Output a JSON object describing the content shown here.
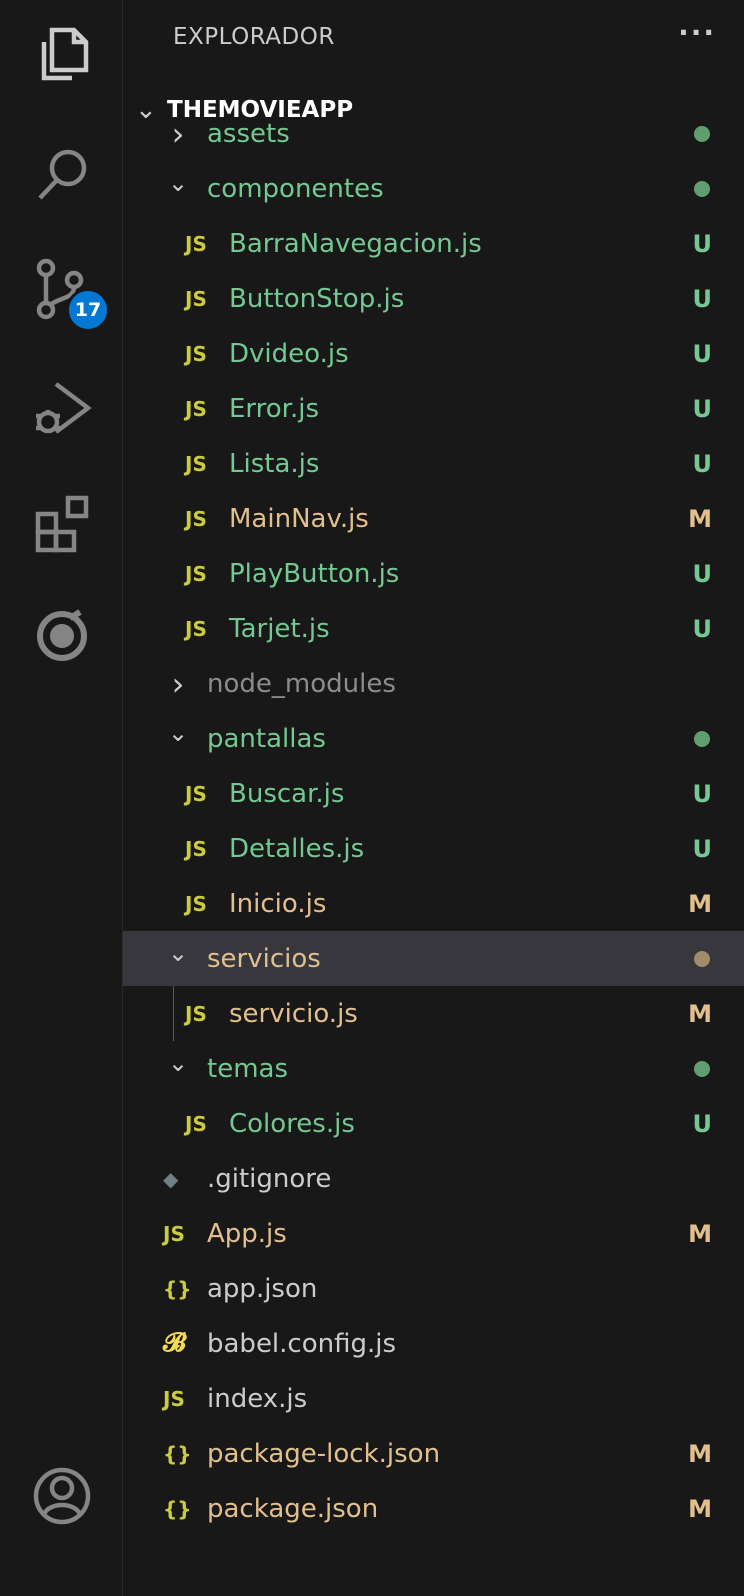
{
  "activity_bar": {
    "items": [
      {
        "icon": "files-icon",
        "name": "explorer"
      },
      {
        "icon": "search-icon",
        "name": "search"
      },
      {
        "icon": "source-control-icon",
        "name": "source-control",
        "badge": "17"
      },
      {
        "icon": "run-debug-icon",
        "name": "run-and-debug"
      },
      {
        "icon": "extensions-icon",
        "name": "extensions"
      },
      {
        "icon": "remote-icon",
        "name": "remote"
      }
    ],
    "account_icon": "account-icon"
  },
  "explorer": {
    "title": "EXPLORADOR",
    "more": "···",
    "project": "THEMOVIEAPP"
  },
  "tree": [
    {
      "type": "folder",
      "label": "assets",
      "open": false,
      "depth": 1,
      "color": "green",
      "status_dot": true,
      "partial": true
    },
    {
      "type": "folder",
      "label": "componentes",
      "open": true,
      "depth": 1,
      "color": "green",
      "status_dot": true
    },
    {
      "type": "js",
      "label": "BarraNavegacion.js",
      "depth": 2,
      "color": "green",
      "status": "U"
    },
    {
      "type": "js",
      "label": "ButtonStop.js",
      "depth": 2,
      "color": "green",
      "status": "U"
    },
    {
      "type": "js",
      "label": "Dvideo.js",
      "depth": 2,
      "color": "green",
      "status": "U"
    },
    {
      "type": "js",
      "label": "Error.js",
      "depth": 2,
      "color": "green",
      "status": "U"
    },
    {
      "type": "js",
      "label": "Lista.js",
      "depth": 2,
      "color": "green",
      "status": "U"
    },
    {
      "type": "js",
      "label": "MainNav.js",
      "depth": 2,
      "color": "yellow",
      "status": "M"
    },
    {
      "type": "js",
      "label": "PlayButton.js",
      "depth": 2,
      "color": "green",
      "status": "U"
    },
    {
      "type": "js",
      "label": "Tarjet.js",
      "depth": 2,
      "color": "green",
      "status": "U"
    },
    {
      "type": "folder",
      "label": "node_modules",
      "open": false,
      "depth": 1,
      "color": "gray"
    },
    {
      "type": "folder",
      "label": "pantallas",
      "open": true,
      "depth": 1,
      "color": "green",
      "status_dot": true
    },
    {
      "type": "js",
      "label": "Buscar.js",
      "depth": 2,
      "color": "green",
      "status": "U"
    },
    {
      "type": "js",
      "label": "Detalles.js",
      "depth": 2,
      "color": "green",
      "status": "U"
    },
    {
      "type": "js",
      "label": "Inicio.js",
      "depth": 2,
      "color": "yellow",
      "status": "M"
    },
    {
      "type": "folder",
      "label": "servicios",
      "open": true,
      "depth": 1,
      "color": "yellow",
      "status_dot": true,
      "selected": true
    },
    {
      "type": "js",
      "label": "servicio.js",
      "depth": 2,
      "color": "yellow",
      "status": "M"
    },
    {
      "type": "folder",
      "label": "temas",
      "open": true,
      "depth": 1,
      "color": "green",
      "status_dot": true
    },
    {
      "type": "js",
      "label": "Colores.js",
      "depth": 2,
      "color": "green",
      "status": "U"
    },
    {
      "type": "git",
      "label": ".gitignore",
      "depth": 0,
      "color": "white"
    },
    {
      "type": "js",
      "label": "App.js",
      "depth": 0,
      "color": "yellow",
      "status": "M"
    },
    {
      "type": "json",
      "label": "app.json",
      "depth": 0,
      "color": "white"
    },
    {
      "type": "babel",
      "label": "babel.config.js",
      "depth": 0,
      "color": "white"
    },
    {
      "type": "js",
      "label": "index.js",
      "depth": 0,
      "color": "white"
    },
    {
      "type": "json",
      "label": "package-lock.json",
      "depth": 0,
      "color": "yellow",
      "status": "M"
    },
    {
      "type": "json",
      "label": "package.json",
      "depth": 0,
      "color": "yellow",
      "status": "M"
    }
  ],
  "icon_text": {
    "js": "JS",
    "json": "{}",
    "babel": "𝓑",
    "git": "◆"
  },
  "colors": {
    "green": "#73c991",
    "yellow": "#e2c08d",
    "gray": "#8c8c8c",
    "white": "#cccccc",
    "dot_green": "#5f9f6f",
    "dot_yellow": "#a08b6b",
    "selected_bg": "#37373d",
    "badge": "#0078d4"
  }
}
